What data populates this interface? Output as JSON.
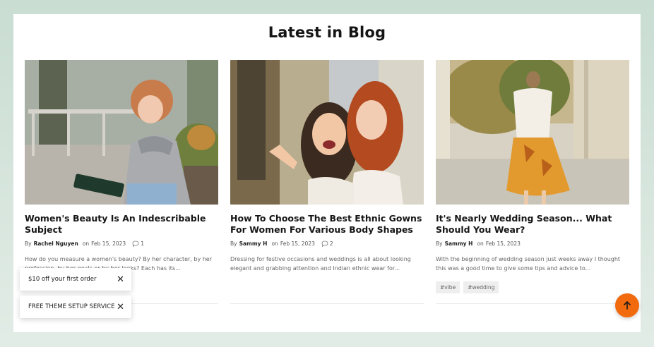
{
  "section": {
    "title": "Latest in Blog"
  },
  "posts": [
    {
      "title": "Women's Beauty Is An Indescribable Subject",
      "by": "By",
      "author": "Rachel Nguyen",
      "on": "on",
      "date": "Feb 15, 2023",
      "comments": "1",
      "excerpt": "How do you measure a women's beauty? By her character, by her profession, by her goals or by her looks? Each has its..."
    },
    {
      "title": "How To Choose The Best Ethnic Gowns For Women For Various Body Shapes",
      "by": "By",
      "author": "Sammy H",
      "on": "on",
      "date": "Feb 15, 2023",
      "comments": "2",
      "excerpt": "Dressing for festive occasions and weddings is all about looking elegant and grabbing attention and Indian ethnic wear for..."
    },
    {
      "title": "It's Nearly Wedding Season... What Should You Wear?",
      "by": "By",
      "author": "Sammy H",
      "on": "on",
      "date": "Feb 15, 2023",
      "excerpt": "With the beginning of wedding season just weeks away I thought this was a good time to give some tips and advice to...",
      "tags": [
        "#vibe",
        "#wedding"
      ]
    }
  ],
  "toasts": [
    {
      "text": "$10 off your first order",
      "close": "✕"
    },
    {
      "text": "FREE THEME SETUP SERVICE",
      "close": "✕"
    }
  ],
  "colors": {
    "accent": "#f26a0e",
    "background": "#d3e4da"
  },
  "icons": {
    "comment": "comment-bubble-icon",
    "back_to_top": "arrow-up-icon",
    "close": "close-icon"
  }
}
